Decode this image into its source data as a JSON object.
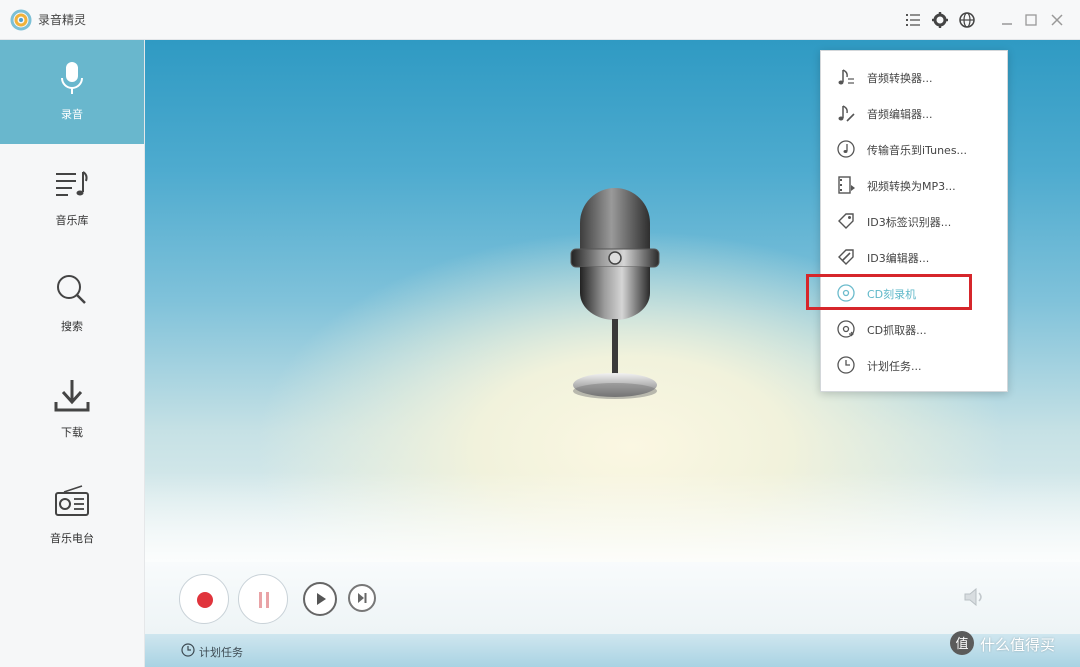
{
  "app": {
    "title": "录音精灵"
  },
  "titlebar": {
    "icons": [
      "list-menu-icon",
      "gear-icon",
      "globe-icon",
      "minimize-icon",
      "maximize-icon",
      "close-icon"
    ]
  },
  "sidebar": {
    "items": [
      {
        "label": "录音",
        "icon": "microphone-icon",
        "active": true
      },
      {
        "label": "音乐库",
        "icon": "music-list-icon",
        "active": false
      },
      {
        "label": "搜索",
        "icon": "search-icon",
        "active": false
      },
      {
        "label": "下载",
        "icon": "download-icon",
        "active": false
      },
      {
        "label": "音乐电台",
        "icon": "radio-icon",
        "active": false
      }
    ]
  },
  "menu": {
    "items": [
      {
        "label": "音频转换器...",
        "icon": "audio-convert-icon"
      },
      {
        "label": "音频编辑器...",
        "icon": "audio-edit-icon"
      },
      {
        "label": "传输音乐到iTunes...",
        "icon": "itunes-transfer-icon"
      },
      {
        "label": "视频转换为MP3...",
        "icon": "video-to-mp3-icon"
      },
      {
        "label": "ID3标签识别器...",
        "icon": "tag-icon"
      },
      {
        "label": "ID3编辑器...",
        "icon": "tag-edit-icon"
      },
      {
        "label": "CD刻录机",
        "icon": "cd-burn-icon",
        "highlighted": true
      },
      {
        "label": "CD抓取器...",
        "icon": "cd-rip-icon"
      },
      {
        "label": "计划任务...",
        "icon": "clock-icon"
      }
    ]
  },
  "status": {
    "text": "计划任务"
  },
  "watermark": {
    "text": "什么值得买"
  },
  "colors": {
    "accent": "#69b7cd",
    "record": "#e0343c",
    "highlight_border": "#d6262b"
  }
}
